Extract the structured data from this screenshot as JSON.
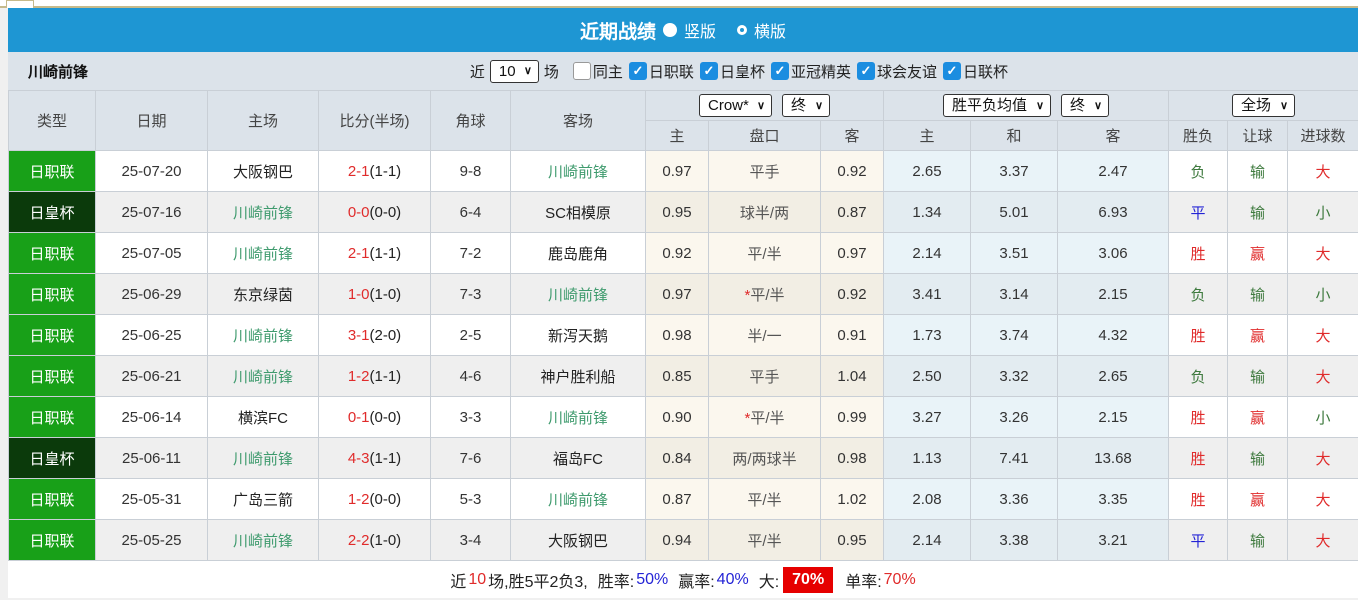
{
  "title_bar": {
    "title": "近期战绩",
    "vertical_label": "竖版",
    "horizontal_label": "横版",
    "selected_layout": "竖版"
  },
  "filter_bar": {
    "team_name": "川崎前锋",
    "recent_label": "近",
    "recent_value": "10",
    "matches_label": "场",
    "checkboxes": [
      {
        "label": "同主",
        "checked": false
      },
      {
        "label": "日职联",
        "checked": true
      },
      {
        "label": "日皇杯",
        "checked": true
      },
      {
        "label": "亚冠精英",
        "checked": true
      },
      {
        "label": "球会友谊",
        "checked": true
      },
      {
        "label": "日联杯",
        "checked": true
      }
    ]
  },
  "table": {
    "main_headers": [
      "类型",
      "日期",
      "主场",
      "比分(半场)",
      "角球",
      "客场"
    ],
    "dropdowns": {
      "handicap_company": "Crow*",
      "handicap_time": "终",
      "europe_company": "胜平负均值",
      "europe_time": "终",
      "result_scope": "全场"
    },
    "sub_headers": {
      "handicap": [
        "主",
        "盘口",
        "客"
      ],
      "europe": [
        "主",
        "和",
        "客"
      ],
      "result": [
        "胜负",
        "让球",
        "进球数"
      ]
    },
    "rows": [
      {
        "type": "日职联",
        "type_class": "league",
        "date": "25-07-20",
        "home": "大阪钢巴",
        "home_hl": false,
        "score": "2-1",
        "half": "(1-1)",
        "corner": "9-8",
        "away": "川崎前锋",
        "away_hl": true,
        "h_home": "0.97",
        "handicap": "平手",
        "star": false,
        "h_away": "0.92",
        "e_home": "2.65",
        "e_draw": "3.37",
        "e_away": "2.47",
        "wdl": "负",
        "wdl_c": "green",
        "let": "输",
        "let_c": "green",
        "goal": "大",
        "goal_c": "red"
      },
      {
        "type": "日皇杯",
        "type_class": "cup",
        "date": "25-07-16",
        "home": "川崎前锋",
        "home_hl": true,
        "score": "0-0",
        "half": "(0-0)",
        "corner": "6-4",
        "away": "SC相模原",
        "away_hl": false,
        "h_home": "0.95",
        "handicap": "球半/两",
        "star": false,
        "h_away": "0.87",
        "e_home": "1.34",
        "e_draw": "5.01",
        "e_away": "6.93",
        "wdl": "平",
        "wdl_c": "blue",
        "let": "输",
        "let_c": "green",
        "goal": "小",
        "goal_c": "green"
      },
      {
        "type": "日职联",
        "type_class": "league",
        "date": "25-07-05",
        "home": "川崎前锋",
        "home_hl": true,
        "score": "2-1",
        "half": "(1-1)",
        "corner": "7-2",
        "away": "鹿岛鹿角",
        "away_hl": false,
        "h_home": "0.92",
        "handicap": "平/半",
        "star": false,
        "h_away": "0.97",
        "e_home": "2.14",
        "e_draw": "3.51",
        "e_away": "3.06",
        "wdl": "胜",
        "wdl_c": "red",
        "let": "赢",
        "let_c": "red",
        "goal": "大",
        "goal_c": "red"
      },
      {
        "type": "日职联",
        "type_class": "league",
        "date": "25-06-29",
        "home": "东京绿茵",
        "home_hl": false,
        "score": "1-0",
        "half": "(1-0)",
        "corner": "7-3",
        "away": "川崎前锋",
        "away_hl": true,
        "h_home": "0.97",
        "handicap": "平/半",
        "star": true,
        "h_away": "0.92",
        "e_home": "3.41",
        "e_draw": "3.14",
        "e_away": "2.15",
        "wdl": "负",
        "wdl_c": "green",
        "let": "输",
        "let_c": "green",
        "goal": "小",
        "goal_c": "green"
      },
      {
        "type": "日职联",
        "type_class": "league",
        "date": "25-06-25",
        "home": "川崎前锋",
        "home_hl": true,
        "score": "3-1",
        "half": "(2-0)",
        "corner": "2-5",
        "away": "新泻天鹅",
        "away_hl": false,
        "h_home": "0.98",
        "handicap": "半/一",
        "star": false,
        "h_away": "0.91",
        "e_home": "1.73",
        "e_draw": "3.74",
        "e_away": "4.32",
        "wdl": "胜",
        "wdl_c": "red",
        "let": "赢",
        "let_c": "red",
        "goal": "大",
        "goal_c": "red"
      },
      {
        "type": "日职联",
        "type_class": "league",
        "date": "25-06-21",
        "home": "川崎前锋",
        "home_hl": true,
        "score": "1-2",
        "half": "(1-1)",
        "corner": "4-6",
        "away": "神户胜利船",
        "away_hl": false,
        "h_home": "0.85",
        "handicap": "平手",
        "star": false,
        "h_away": "1.04",
        "e_home": "2.50",
        "e_draw": "3.32",
        "e_away": "2.65",
        "wdl": "负",
        "wdl_c": "green",
        "let": "输",
        "let_c": "green",
        "goal": "大",
        "goal_c": "red"
      },
      {
        "type": "日职联",
        "type_class": "league",
        "date": "25-06-14",
        "home": "横滨FC",
        "home_hl": false,
        "score": "0-1",
        "half": "(0-0)",
        "corner": "3-3",
        "away": "川崎前锋",
        "away_hl": true,
        "h_home": "0.90",
        "handicap": "平/半",
        "star": true,
        "h_away": "0.99",
        "e_home": "3.27",
        "e_draw": "3.26",
        "e_away": "2.15",
        "wdl": "胜",
        "wdl_c": "red",
        "let": "赢",
        "let_c": "red",
        "goal": "小",
        "goal_c": "green"
      },
      {
        "type": "日皇杯",
        "type_class": "cup",
        "date": "25-06-11",
        "home": "川崎前锋",
        "home_hl": true,
        "score": "4-3",
        "half": "(1-1)",
        "corner": "7-6",
        "away": "福岛FC",
        "away_hl": false,
        "h_home": "0.84",
        "handicap": "两/两球半",
        "star": false,
        "h_away": "0.98",
        "e_home": "1.13",
        "e_draw": "7.41",
        "e_away": "13.68",
        "wdl": "胜",
        "wdl_c": "red",
        "let": "输",
        "let_c": "green",
        "goal": "大",
        "goal_c": "red"
      },
      {
        "type": "日职联",
        "type_class": "league",
        "date": "25-05-31",
        "home": "广岛三箭",
        "home_hl": false,
        "score": "1-2",
        "half": "(0-0)",
        "corner": "5-3",
        "away": "川崎前锋",
        "away_hl": true,
        "h_home": "0.87",
        "handicap": "平/半",
        "star": false,
        "h_away": "1.02",
        "e_home": "2.08",
        "e_draw": "3.36",
        "e_away": "3.35",
        "wdl": "胜",
        "wdl_c": "red",
        "let": "赢",
        "let_c": "red",
        "goal": "大",
        "goal_c": "red"
      },
      {
        "type": "日职联",
        "type_class": "league",
        "date": "25-05-25",
        "home": "川崎前锋",
        "home_hl": true,
        "score": "2-2",
        "half": "(1-0)",
        "corner": "3-4",
        "away": "大阪钢巴",
        "away_hl": false,
        "h_home": "0.94",
        "handicap": "平/半",
        "star": false,
        "h_away": "0.95",
        "e_home": "2.14",
        "e_draw": "3.38",
        "e_away": "3.21",
        "wdl": "平",
        "wdl_c": "blue",
        "let": "输",
        "let_c": "green",
        "goal": "大",
        "goal_c": "red"
      }
    ]
  },
  "summary": {
    "prefix": "近",
    "match_count": "10",
    "record": "场,胜5平2负3,",
    "win_rate_label": "胜率:",
    "win_rate": "50%",
    "cover_rate_label": "赢率:",
    "cover_rate": "40%",
    "big_label": "大:",
    "big_rate": "70%",
    "single_rate_label": "单率:",
    "single_rate": "70%"
  },
  "colors": {
    "title_bar_blue": "#1e96d3",
    "filter_bar_bg": "#dce3ea",
    "league_badge_green": "#18a018",
    "cup_badge_dark_green": "#0b3a0b",
    "win_red": "#e02b2b",
    "draw_blue": "#2424d6",
    "lose_green": "#3e7a3e",
    "team_highlight_green": "#3f9b6e",
    "big_rate_badge_red": "#e60000",
    "handicap_col_bg": "#fbf7ee",
    "europe_col_bg": "#e9f3f8"
  }
}
